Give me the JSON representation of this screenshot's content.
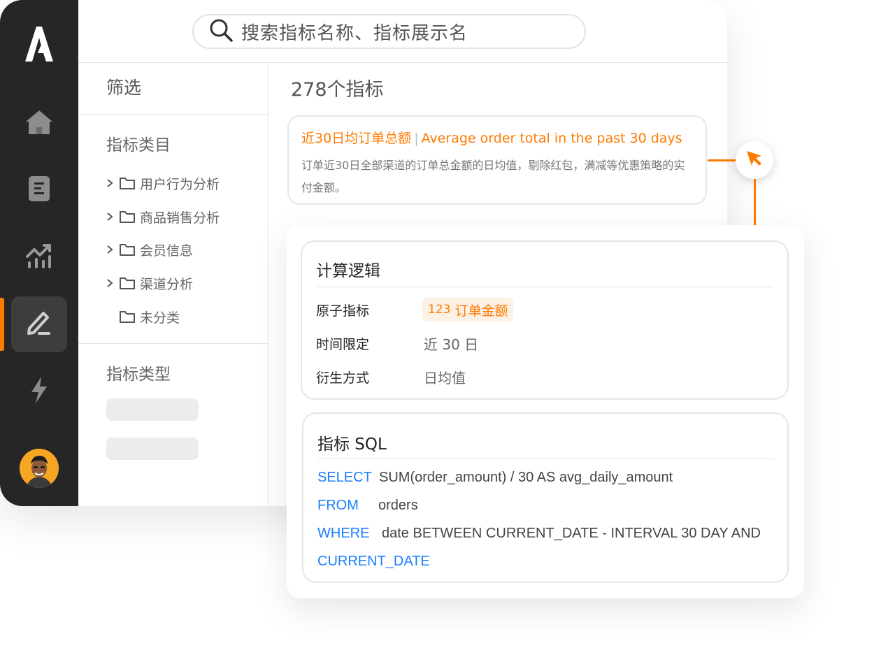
{
  "app": {
    "nav": [
      "home-icon",
      "document-icon",
      "chart-icon",
      "edit-icon",
      "lightning-icon"
    ],
    "active_nav": "edit-icon"
  },
  "search": {
    "text": "搜索指标名称、指标展示名"
  },
  "filter": {
    "title": "筛选",
    "category_title": "指标类目",
    "categories": [
      {
        "label": "用户行为分析",
        "expandable": true
      },
      {
        "label": "商品销售分析",
        "expandable": true
      },
      {
        "label": "会员信息",
        "expandable": true
      },
      {
        "label": "渠道分析",
        "expandable": true
      },
      {
        "label": "未分类",
        "expandable": false
      }
    ],
    "type_title": "指标类型"
  },
  "main": {
    "count": "278个指标",
    "metric": {
      "name": "近30日均订单总额",
      "separator": "|",
      "name_en": "Average order total in the past 30 days",
      "desc": "订单近30日全部渠道的订单总金额的日均值，剔除红包，满减等优惠策略的实付金额。"
    }
  },
  "detail": {
    "logic": {
      "title": "计算逻辑",
      "atom_label": "原子指标",
      "atom_num": "123",
      "atom_value": "订单金额",
      "time_label": "时间限定",
      "time_value": "近 30 日",
      "derive_label": "衍生方式",
      "derive_value": "日均值"
    },
    "sql": {
      "title": "指标 SQL",
      "lines": [
        {
          "kw": "SELECT",
          "code": "SUM(order_amount) / 30 AS avg_daily_amount"
        },
        {
          "kw": "FROM",
          "code": "orders"
        },
        {
          "kw": "WHERE",
          "code": "date BETWEEN CURRENT_DATE - INTERVAL 30 DAY AND"
        },
        {
          "kw": "CURRENT_DATE",
          "code": ""
        }
      ]
    }
  },
  "colors": {
    "accent": "#ff7a00",
    "keyword": "#1a7fff",
    "sidebar": "#262626"
  }
}
